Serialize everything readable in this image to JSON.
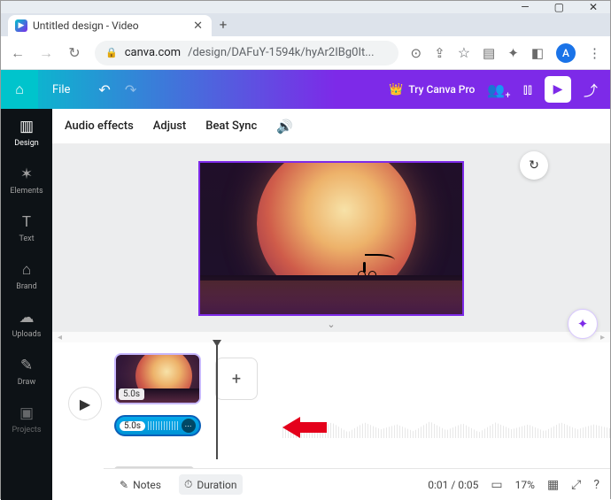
{
  "browser": {
    "tab_title": "Untitled design - Video",
    "url_domain": "canva.com",
    "url_path": "/design/DAFuY-1594k/hyAr2IBg0It...",
    "profile_letter": "A"
  },
  "topbar": {
    "file": "File",
    "try_pro": "Try Canva Pro"
  },
  "sidebar": {
    "items": [
      {
        "label": "Design"
      },
      {
        "label": "Elements"
      },
      {
        "label": "Text"
      },
      {
        "label": "Brand"
      },
      {
        "label": "Uploads"
      },
      {
        "label": "Draw"
      },
      {
        "label": "Projects"
      }
    ]
  },
  "subbar": {
    "audio_effects": "Audio effects",
    "adjust": "Adjust",
    "beat_sync": "Beat Sync"
  },
  "timeline": {
    "clip_duration": "5.0s",
    "audio_duration": "5.0s"
  },
  "footer": {
    "notes": "Notes",
    "duration": "Duration",
    "time": "0:01 / 0:05",
    "zoom": "17%"
  }
}
